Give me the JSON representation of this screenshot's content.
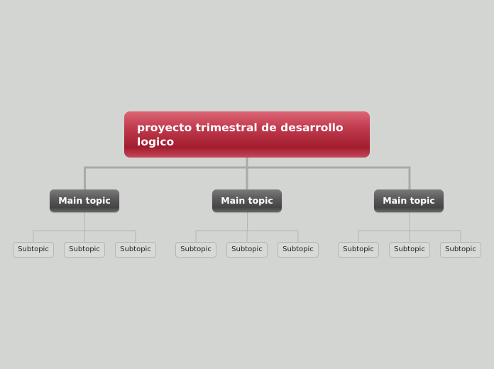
{
  "central_topic": {
    "label": "proyecto trimestral de desarrollo logico",
    "color": "#b52a3d"
  },
  "main_topics": [
    {
      "label": "Main topic",
      "subtopics": [
        "Subtopic",
        "Subtopic",
        "Subtopic"
      ]
    },
    {
      "label": "Main topic",
      "subtopics": [
        "Subtopic",
        "Subtopic",
        "Subtopic"
      ]
    },
    {
      "label": "Main topic",
      "subtopics": [
        "Subtopic",
        "Subtopic",
        "Subtopic"
      ]
    }
  ],
  "colors": {
    "background": "#d3d5d2",
    "main_topic": "#555555",
    "connector": "#a9aba8"
  }
}
